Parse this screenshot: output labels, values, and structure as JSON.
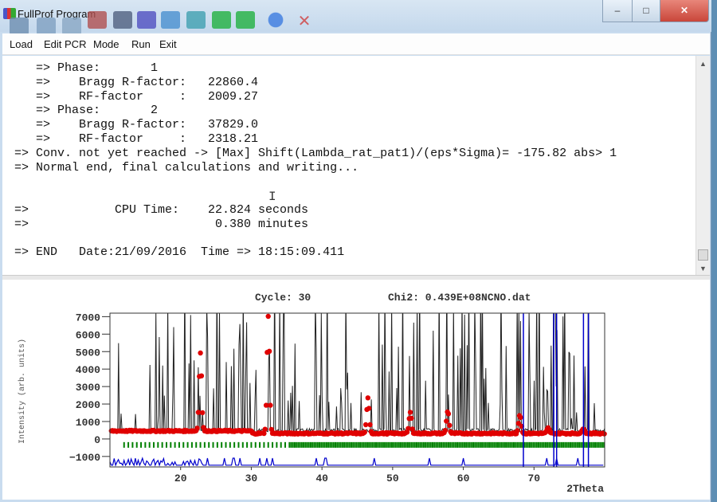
{
  "window": {
    "title": "FullProf Program",
    "minimize": "–",
    "maximize": "□",
    "close": "✕"
  },
  "toolbar": {
    "icons": [
      "plot-icon",
      "edit-icon",
      "file-icon",
      "winplotr-icon",
      "data-icon",
      "pattern-icon",
      "structure-icon",
      "image-icon",
      "tool-green-1-icon",
      "tool-green-2-icon",
      "help-icon",
      "stop-icon"
    ],
    "colors": [
      "#6e8fb0",
      "#7fa0c0",
      "#8aa7c4",
      "#b05050",
      "#506080",
      "#5050c0",
      "#4a90d0",
      "#40a0b0",
      "#20b040",
      "#20b040",
      "#1f5fd0",
      "#d04040"
    ]
  },
  "menu": {
    "items": [
      "Load",
      "Edit PCR",
      "Mode",
      "Run",
      "Exit"
    ]
  },
  "console": {
    "lines": [
      "   => Phase:       1",
      "   =>    Bragg R-factor:   22860.4",
      "   =>    RF-factor     :   2009.27",
      "   => Phase:       2",
      "   =>    Bragg R-factor:   37829.0",
      "   =>    RF-factor     :   2318.21",
      "=> Conv. not yet reached -> [Max] Shift(Lambda_rat_pat1)/(eps*Sigma)= -175.82 abs> 1",
      "=> Normal end, final calculations and writing...",
      "",
      "",
      "=>            CPU Time:    22.824 seconds",
      "=>                          0.380 minutes",
      "",
      "=> END   Date:21/09/2016  Time => 18:15:09.411"
    ]
  },
  "chart_data": {
    "type": "line",
    "title": "Cycle: 30      Chi2: 0.439E+08NCNO.dat",
    "cycle_label": "Cycle: 30",
    "chi2_label": "Chi2: 0.439E+08NCNO.dat",
    "xlabel": "2Theta",
    "ylabel": "Intensity (arb. units)",
    "xlim": [
      10,
      80
    ],
    "ylim": [
      -1600,
      7200
    ],
    "xticks": [
      20,
      30,
      40,
      50,
      60,
      70
    ],
    "yticks": [
      7000,
      6000,
      5000,
      4000,
      3000,
      2000,
      1000,
      0,
      -1000
    ],
    "ytick_labels": [
      "7000",
      "6000",
      "5000",
      "4000",
      "3000",
      "2000",
      "1000",
      "0",
      "−1000"
    ],
    "xtick_labels": [
      "20",
      "30",
      "40",
      "50",
      "60",
      "70"
    ],
    "series": [
      {
        "name": "observed",
        "color": "#e00000",
        "baseline": 350,
        "peaks": [
          [
            22.8,
            4500
          ],
          [
            32.4,
            6700
          ],
          [
            46.5,
            2000
          ],
          [
            52.5,
            1200
          ],
          [
            57.8,
            1300
          ],
          [
            68,
            1100
          ],
          [
            72,
            300
          ],
          [
            77,
            300
          ]
        ]
      },
      {
        "name": "calculated",
        "color": "#000000"
      },
      {
        "name": "bragg_positions",
        "color": "#007a00"
      },
      {
        "name": "difference",
        "color": "#0000cc",
        "offset": -1200
      }
    ]
  }
}
